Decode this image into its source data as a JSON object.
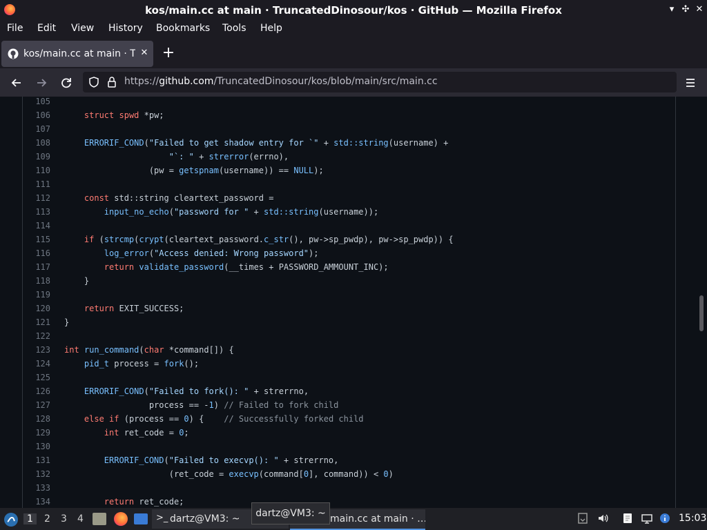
{
  "window": {
    "title": "kos/main.cc at main · TruncatedDinosour/kos · GitHub — Mozilla Firefox"
  },
  "menu": [
    "File",
    "Edit",
    "View",
    "History",
    "Bookmarks",
    "Tools",
    "Help"
  ],
  "tab": {
    "title": "kos/main.cc at main · TruncatedDinosour/kos",
    "close_icon": "close-icon"
  },
  "url": {
    "protocol": "https://",
    "host": "github.com",
    "path": "/TruncatedDinosour/kos/blob/main/src/main.cc"
  },
  "code_lines": [
    {
      "n": "105",
      "html": ""
    },
    {
      "n": "106",
      "html": "    <span class=\"k\">struct</span> <span class=\"k\">spwd</span> *pw;"
    },
    {
      "n": "107",
      "html": ""
    },
    {
      "n": "108",
      "html": "    <span class=\"f\">ERRORIF_COND</span>(<span class=\"s\">\"Failed to get shadow entry for `\"</span> + <span class=\"f\">std::string</span>(username) +"
    },
    {
      "n": "109",
      "html": "                     <span class=\"s\">\"`: \"</span> + <span class=\"f\">strerror</span>(errno),"
    },
    {
      "n": "110",
      "html": "                 (pw = <span class=\"f\">getspnam</span>(username)) == <span class=\"f\">NULL</span>);"
    },
    {
      "n": "111",
      "html": ""
    },
    {
      "n": "112",
      "html": "    <span class=\"k\">const</span> std::string cleartext_password ="
    },
    {
      "n": "113",
      "html": "        <span class=\"f\">input_no_echo</span>(<span class=\"s\">\"password for \"</span> + <span class=\"f\">std::string</span>(username));"
    },
    {
      "n": "114",
      "html": ""
    },
    {
      "n": "115",
      "html": "    <span class=\"k\">if</span> (<span class=\"f\">strcmp</span>(<span class=\"f\">crypt</span>(cleartext_password.<span class=\"f\">c_str</span>(), pw->sp_pwdp), pw->sp_pwdp)) {"
    },
    {
      "n": "116",
      "html": "        <span class=\"f\">log_error</span>(<span class=\"s\">\"Access denied: Wrong password\"</span>);"
    },
    {
      "n": "117",
      "html": "        <span class=\"k\">return</span> <span class=\"f\">validate_password</span>(__times + PASSWORD_AMMOUNT_INC);"
    },
    {
      "n": "118",
      "html": "    }"
    },
    {
      "n": "119",
      "html": ""
    },
    {
      "n": "120",
      "html": "    <span class=\"k\">return</span> EXIT_SUCCESS;"
    },
    {
      "n": "121",
      "html": "}"
    },
    {
      "n": "122",
      "html": ""
    },
    {
      "n": "123",
      "html": "<span class=\"k\">int</span> <span class=\"f\">run_command</span>(<span class=\"k\">char</span> *command[]) {"
    },
    {
      "n": "124",
      "html": "    <span class=\"f\">pid_t</span> process = <span class=\"f\">fork</span>();"
    },
    {
      "n": "125",
      "html": ""
    },
    {
      "n": "126",
      "html": "    <span class=\"f\">ERRORIF_COND</span>(<span class=\"s\">\"Failed to fork(): \"</span> + strerrno,"
    },
    {
      "n": "127",
      "html": "                 process == -<span class=\"f\">1</span>) <span class=\"c\">// Failed to fork child</span>"
    },
    {
      "n": "128",
      "html": "    <span class=\"k\">else</span> <span class=\"k\">if</span> (process == <span class=\"f\">0</span>) {    <span class=\"c\">// Successfully forked child</span>"
    },
    {
      "n": "129",
      "html": "        <span class=\"k\">int</span> ret_code = <span class=\"f\">0</span>;"
    },
    {
      "n": "130",
      "html": ""
    },
    {
      "n": "131",
      "html": "        <span class=\"f\">ERRORIF_COND</span>(<span class=\"s\">\"Failed to execvp(): \"</span> + strerrno,"
    },
    {
      "n": "132",
      "html": "                     (ret_code = <span class=\"f\">execvp</span>(command[<span class=\"f\">0</span>], command)) < <span class=\"f\">0</span>)"
    },
    {
      "n": "133",
      "html": ""
    },
    {
      "n": "134",
      "html": "        <span class=\"k\">return</span> ret_code;"
    }
  ],
  "taskbar": {
    "workspaces": [
      "1",
      "2",
      "3",
      "4"
    ],
    "tasks": {
      "terminal": "dartz@VM3: ~",
      "browser": "main.cc at main · …"
    },
    "tooltip": "dartz@VM3: ~",
    "clock": "15:03"
  },
  "colors": {
    "accent": "#5294e2",
    "keyword": "#ff7b72",
    "function": "#79c0ff",
    "string": "#a5d6ff",
    "comment": "#8b949e"
  }
}
